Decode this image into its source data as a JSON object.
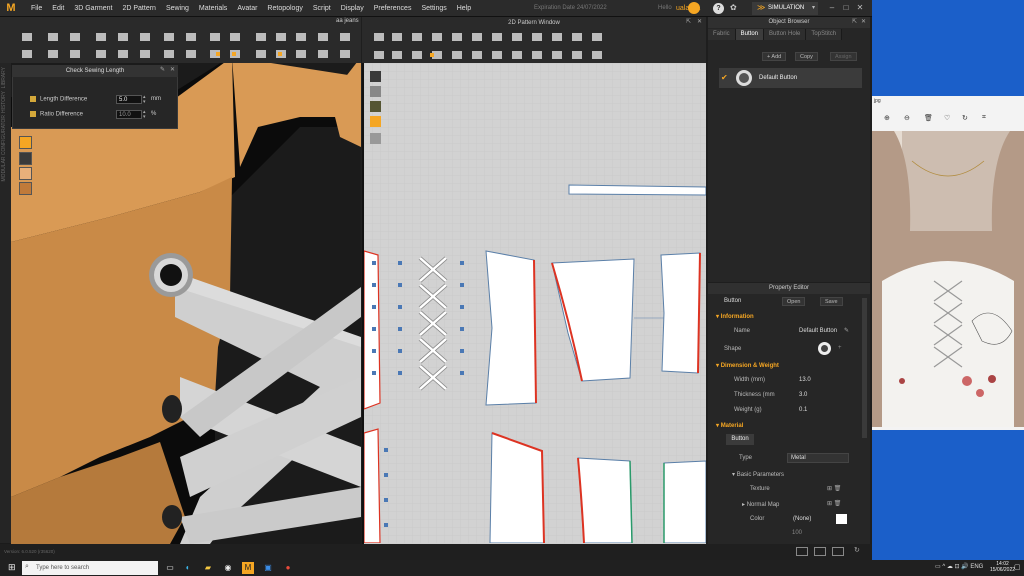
{
  "menubar": {
    "logo": "M",
    "items": [
      "File",
      "Edit",
      "3D Garment",
      "2D Pattern",
      "Sewing",
      "Materials",
      "Avatar",
      "Retopology",
      "Script",
      "Display",
      "Preferences",
      "Settings",
      "Help"
    ],
    "expiration": "Expiration Date 24/07/2022",
    "hello": "Hello",
    "username": "ualas01",
    "mode": "SIMULATION",
    "accent": "#f5a623"
  },
  "viewport3d": {
    "filename": "aa jeans",
    "sidebar_labels": [
      "LIBRARY",
      "HISTORY",
      "MODULAR CONFIGURATOR"
    ]
  },
  "check_sewing": {
    "title": "Check Sewing Length",
    "rows": [
      {
        "label": "Length Difference",
        "value": "5.0",
        "unit": "mm"
      },
      {
        "label": "Ratio Difference",
        "value": "10.0",
        "unit": "%"
      }
    ]
  },
  "pattern_window": {
    "title": "2D Pattern Window"
  },
  "object_browser": {
    "title": "Object Browser",
    "tabs": [
      "Fabric",
      "Button",
      "Button Hole",
      "TopStitch"
    ],
    "active_tab": "Button",
    "actions": [
      "+ Add",
      "Copy",
      "Assign"
    ],
    "items": [
      {
        "name": "Default Button"
      }
    ]
  },
  "property_editor": {
    "title": "Property Editor",
    "object_type": "Button",
    "open_label": "Open",
    "save_label": "Save",
    "sections": {
      "information": "Information",
      "dimension": "Dimension & Weight",
      "material": "Material"
    },
    "name_label": "Name",
    "name_value": "Default Button",
    "shape_label": "Shape",
    "width_label": "Width (mm)",
    "width_value": "13.0",
    "thickness_label": "Thickness (mm",
    "thickness_value": "3.0",
    "weight_label": "Weight (g)",
    "weight_value": "0.1",
    "material_tab": "Button",
    "type_label": "Type",
    "type_value": "Metal",
    "basic_params": "Basic Parameters",
    "texture_label": "Texture",
    "normal_label": "Normal Map",
    "color_label": "Color",
    "color_value": "(None)",
    "last_value": "100"
  },
  "statusbar": {
    "version": "Version: 6.0.520 (r35620)"
  },
  "photo_app": {
    "title_fragment": "jpg"
  },
  "taskbar": {
    "search_placeholder": "Type here to search",
    "time": "14:02",
    "date": "15/06/2022"
  }
}
